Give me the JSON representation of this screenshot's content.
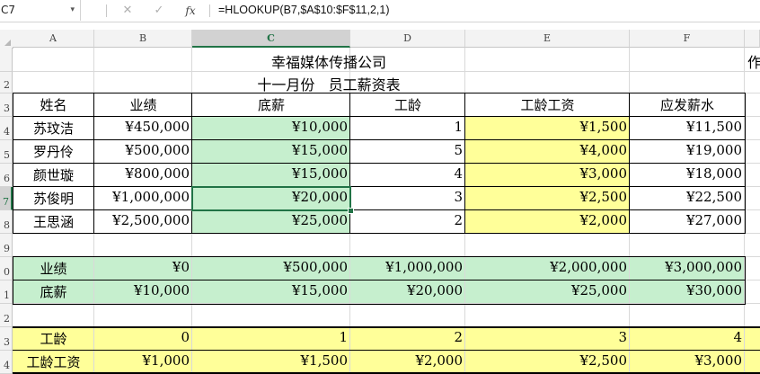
{
  "formula_bar": {
    "name_box": "C7",
    "name_box_arrow": "▾",
    "cancel_icon": "✕",
    "enter_icon": "✓",
    "fx_label": "fx",
    "formula": "=HLOOKUP(B7,$A$10:$F$11,2,1)"
  },
  "column_headers": [
    "A",
    "B",
    "C",
    "D",
    "E",
    "F"
  ],
  "selected_column": "C",
  "row_headers": [
    "",
    "2",
    "3",
    "4",
    "5",
    "6",
    "7",
    "8",
    "9",
    "0",
    "1",
    "2",
    "3",
    "4"
  ],
  "selected_row": "7",
  "cell_colors": {
    "green_fill": "#c6efce",
    "yellow_fill": "#ffff99",
    "selection": "#217346"
  },
  "sheet": {
    "company_title": "幸福媒体传播公司",
    "overflow_text": "作",
    "table_title": "十一月份   员工薪资表",
    "salary_table": {
      "headers": [
        "姓名",
        "业绩",
        "底薪",
        "工龄",
        "工龄工资",
        "应发薪水"
      ],
      "rows": [
        [
          "苏玟洁",
          "¥450,000",
          "¥10,000",
          "1",
          "¥1,500",
          "¥11,500"
        ],
        [
          "罗丹伶",
          "¥500,000",
          "¥15,000",
          "5",
          "¥4,000",
          "¥19,000"
        ],
        [
          "颜世璇",
          "¥800,000",
          "¥15,000",
          "4",
          "¥3,000",
          "¥18,000"
        ],
        [
          "苏俊明",
          "¥1,000,000",
          "¥20,000",
          "3",
          "¥2,500",
          "¥22,500"
        ],
        [
          "王思涵",
          "¥2,500,000",
          "¥25,000",
          "2",
          "¥2,000",
          "¥27,000"
        ]
      ]
    },
    "lookup_table_1": {
      "rows": [
        [
          "业绩",
          "¥0",
          "¥500,000",
          "¥1,000,000",
          "¥2,000,000",
          "¥3,000,000"
        ],
        [
          "底薪",
          "¥10,000",
          "¥15,000",
          "¥20,000",
          "¥25,000",
          "¥30,000"
        ]
      ]
    },
    "lookup_table_2": {
      "rows": [
        [
          "工龄",
          "0",
          "1",
          "2",
          "3",
          "4"
        ],
        [
          "工龄工资",
          "¥1,000",
          "¥1,500",
          "¥2,000",
          "¥2,500",
          "¥3,000"
        ]
      ]
    }
  }
}
